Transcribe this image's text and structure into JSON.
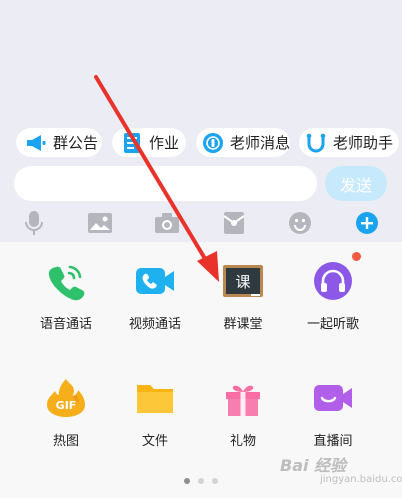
{
  "quick_bar": {
    "items": [
      {
        "label": "群公告",
        "icon": "megaphone-icon"
      },
      {
        "label": "作业",
        "icon": "document-icon"
      },
      {
        "label": "老师消息",
        "icon": "teacher-badge-icon"
      },
      {
        "label": "老师助手",
        "icon": "assistant-icon"
      }
    ]
  },
  "input": {
    "value": "",
    "placeholder": ""
  },
  "send_label": "发送",
  "toolbar": {
    "icons": [
      "microphone-icon",
      "image-icon",
      "camera-icon",
      "red-packet-icon",
      "emoji-icon",
      "plus-icon"
    ]
  },
  "features": {
    "row1": [
      {
        "label": "语音通话",
        "icon": "phone-icon"
      },
      {
        "label": "视频通话",
        "icon": "video-call-icon"
      },
      {
        "label": "群课堂",
        "icon": "classroom-board-icon",
        "icon_text": "课"
      },
      {
        "label": "一起听歌",
        "icon": "headphones-icon",
        "badge": true
      }
    ],
    "row2": [
      {
        "label": "热图",
        "icon": "gif-icon",
        "icon_text": "GIF"
      },
      {
        "label": "文件",
        "icon": "folder-icon"
      },
      {
        "label": "礼物",
        "icon": "gift-icon"
      },
      {
        "label": "直播间",
        "icon": "live-room-icon"
      }
    ]
  },
  "pager": {
    "pages": 3,
    "current": 1
  },
  "watermark": {
    "text": "Bai 经验",
    "subtext": "jingyan.baidu.com"
  },
  "colors": {
    "accent": "#1aa3f0",
    "send_disabled": "#c6e9fb",
    "badge_red": "#f05a3e",
    "arrow_red": "#e8322a",
    "background": "#ecedf4",
    "panel": "#f8f8f8"
  }
}
